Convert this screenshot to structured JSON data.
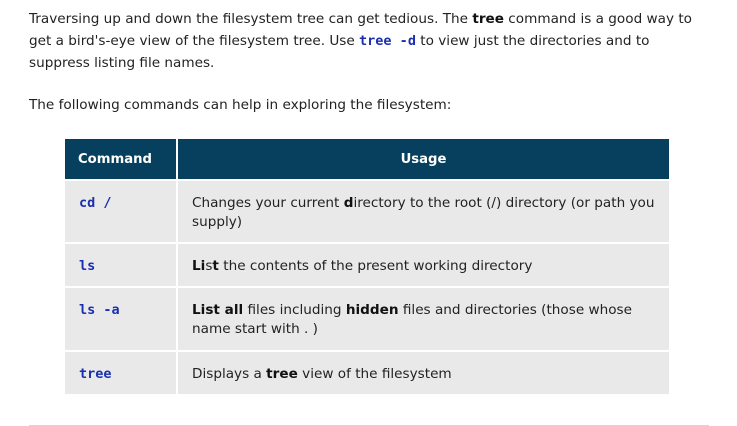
{
  "intro": {
    "part1": "Traversing up and down the filesystem tree can get tedious. The ",
    "bold1": "tree",
    "part2": " command is a good way to get a bird's-eye view of the filesystem tree. Use ",
    "code1": "tree -d",
    "part3": " to view just the directories and to suppress listing file names."
  },
  "lead": "The following commands can help in exploring the filesystem:",
  "table": {
    "headers": {
      "command": "Command",
      "usage": "Usage"
    },
    "rows": [
      {
        "command": "cd /",
        "usage": [
          {
            "t": "Changes your current ",
            "b": false
          },
          {
            "t": "d",
            "b": true
          },
          {
            "t": "irectory to the root (/) directory (or path you supply)",
            "b": false
          }
        ]
      },
      {
        "command": "ls",
        "usage": [
          {
            "t": "Li",
            "b": true
          },
          {
            "t": "s",
            "b": false
          },
          {
            "t": "t",
            "b": true
          },
          {
            "t": " the contents of the present working directory",
            "b": false
          }
        ]
      },
      {
        "command": "ls -a",
        "usage": [
          {
            "t": "List ",
            "b": true
          },
          {
            "t": "all",
            "b": true
          },
          {
            "t": " files including ",
            "b": false
          },
          {
            "t": "hidden",
            "b": true
          },
          {
            "t": " files and directories (those whose name start with . )",
            "b": false
          }
        ]
      },
      {
        "command": "tree",
        "usage": [
          {
            "t": "Displays a ",
            "b": false
          },
          {
            "t": "tree",
            "b": true
          },
          {
            "t": " view of the filesystem",
            "b": false
          }
        ]
      }
    ]
  }
}
